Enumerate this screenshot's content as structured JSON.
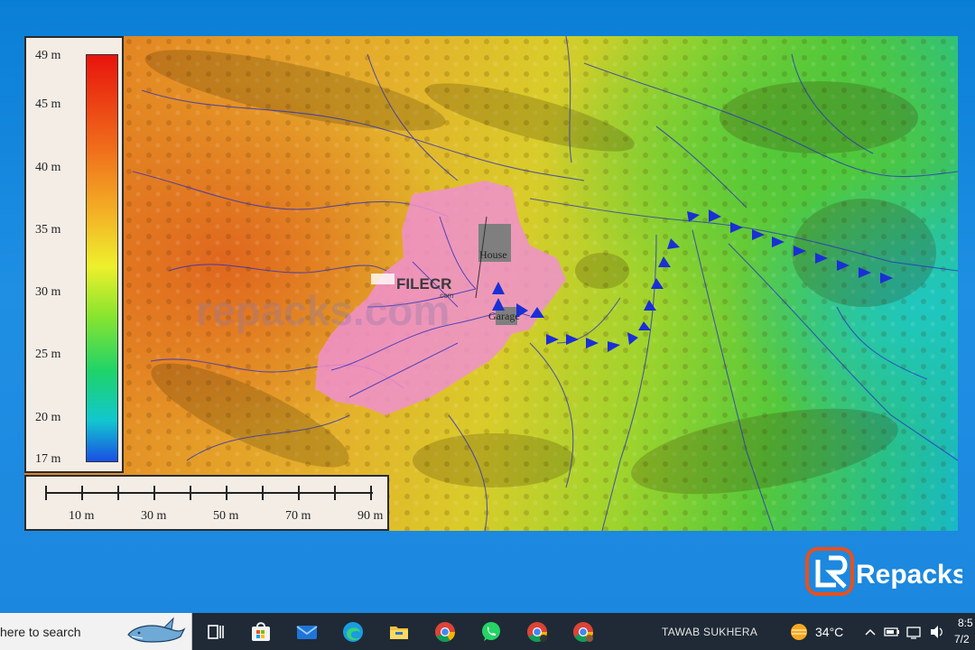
{
  "legend": {
    "ticks": [
      "49 m",
      "45 m",
      "40 m",
      "35 m",
      "30 m",
      "25 m",
      "20 m",
      "17 m"
    ]
  },
  "scale_bar": {
    "labels": [
      "10 m",
      "30 m",
      "50 m",
      "70 m",
      "90 m"
    ]
  },
  "map": {
    "house_label": "House",
    "garage_label": "Garage",
    "watermark": "FILECR",
    "watermark_sub": ".com",
    "watermark_bg": "repacks.com"
  },
  "corner_logo": {
    "text": "Repacks"
  },
  "taskbar": {
    "search_text": "here to search",
    "user_name": "TAWAB SUKHERA",
    "temperature": "34°C",
    "clock_time": "8:5",
    "clock_date": "7/2"
  },
  "colors": {
    "desktop_blue": "#1e8fe3",
    "taskbar": "#1f2a36",
    "catchment_pink": "#f08fd0",
    "flow_arrows": "#1a2fd6"
  }
}
